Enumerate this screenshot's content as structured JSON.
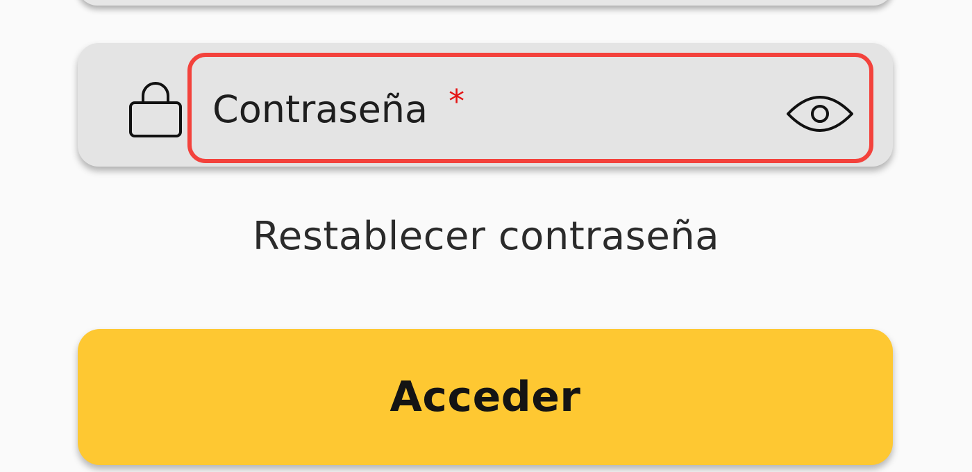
{
  "password_field": {
    "label": "Contraseña",
    "required_marker": "*",
    "leading_icon": "lock-icon",
    "trailing_icon": "eye-icon"
  },
  "reset_password": {
    "label": "Restablecer contraseña"
  },
  "submit": {
    "label": "Acceder"
  },
  "colors": {
    "background": "#fafafa",
    "field_background": "#e4e4e4",
    "error_outline": "#f3423c",
    "required_marker": "#e41414",
    "button_background": "#fec832",
    "text": "#1e1e1e"
  }
}
